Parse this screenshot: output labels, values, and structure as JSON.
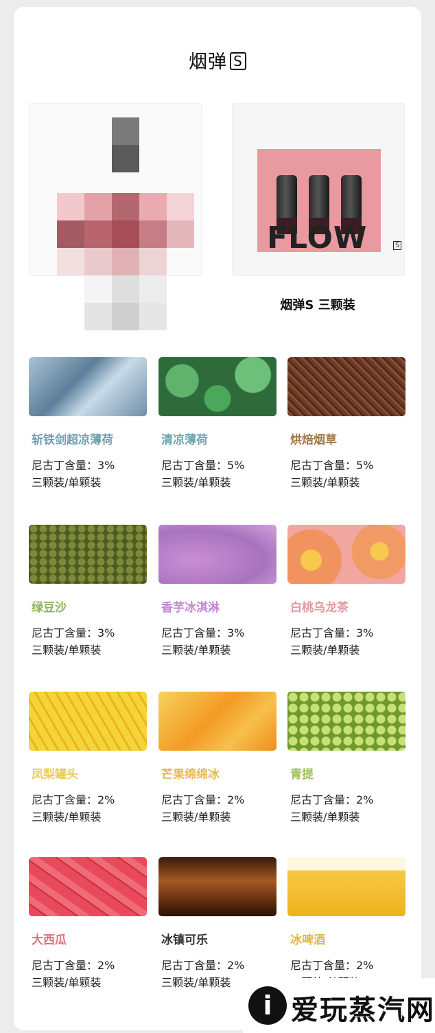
{
  "header": {
    "title": "烟弹",
    "title_badge": "S"
  },
  "products": [
    {
      "id": "device",
      "caption": ""
    },
    {
      "id": "pods",
      "caption": "烟弹S 三颗装",
      "brand_word": "FLOW",
      "brand_badge": "S",
      "pack_note_left": "FLOW\n烟弹S",
      "pack_note_right": "烟弹S"
    }
  ],
  "flavors": [
    {
      "name": "斩铁剑超凉薄荷",
      "color": "#6e9fb0",
      "nicotine": "尼古丁含量：3%",
      "pack": "三颗装/单颗装",
      "image": "ice"
    },
    {
      "name": "清凉薄荷",
      "color": "#6aa7b0",
      "nicotine": "尼古丁含量：5%",
      "pack": "三颗装/单颗装",
      "image": "mint"
    },
    {
      "name": "烘焙烟草",
      "color": "#a07a48",
      "nicotine": "尼古丁含量：5%",
      "pack": "三颗装/单颗装",
      "image": "tobacco"
    },
    {
      "name": "绿豆沙",
      "color": "#8eb35a",
      "nicotine": "尼古丁含量：3%",
      "pack": "三颗装/单颗装",
      "image": "bean"
    },
    {
      "name": "香芋冰淇淋",
      "color": "#c08ad0",
      "nicotine": "尼古丁含量：3%",
      "pack": "三颗装/单颗装",
      "image": "taro"
    },
    {
      "name": "白桃乌龙茶",
      "color": "#e29aa2",
      "nicotine": "尼古丁含量：3%",
      "pack": "三颗装/单颗装",
      "image": "peach"
    },
    {
      "name": "凤梨罐头",
      "color": "#e8cd5a",
      "nicotine": "尼古丁含量：2%",
      "pack": "三颗装/单颗装",
      "image": "pine"
    },
    {
      "name": "芒果绵绵冰",
      "color": "#e9b84e",
      "nicotine": "尼古丁含量：2%",
      "pack": "三颗装/单颗装",
      "image": "mango"
    },
    {
      "name": "青提",
      "color": "#9ec25a",
      "nicotine": "尼古丁含量：2%",
      "pack": "三颗装/单颗装",
      "image": "grape"
    },
    {
      "name": "大西瓜",
      "color": "#e0707c",
      "nicotine": "尼古丁含量：2%",
      "pack": "三颗装/单颗装",
      "image": "melon"
    },
    {
      "name": "冰镇可乐",
      "color": "#333333",
      "nicotine": "尼古丁含量：2%",
      "pack": "三颗装/单颗装",
      "image": "cola"
    },
    {
      "name": "冰啤酒",
      "color": "#e6b73c",
      "nicotine": "尼古丁含量：2%",
      "pack": "三颗装/单颗装",
      "image": "beer"
    }
  ],
  "watermark": {
    "text": "爱玩蒸汽网",
    "icon": "i"
  }
}
